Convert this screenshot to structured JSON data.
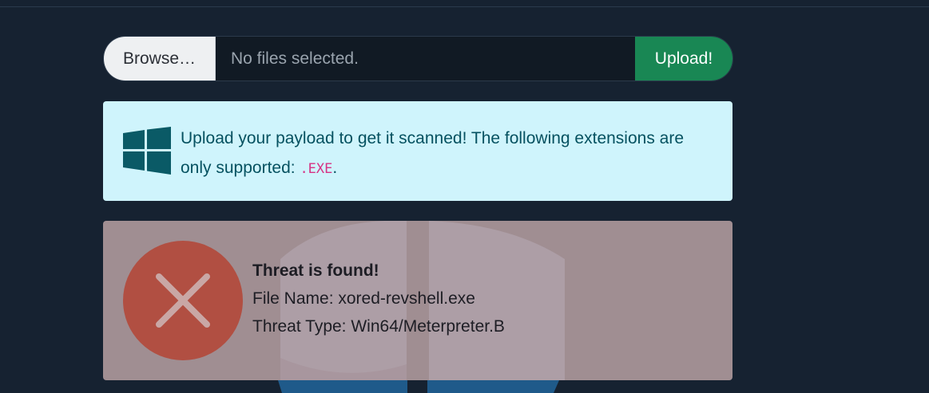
{
  "upload": {
    "browse_label": "Browse…",
    "file_status": "No files selected.",
    "upload_label": "Upload!"
  },
  "info_alert": {
    "icon": "windows-logo-icon",
    "text_before": "Upload your payload to get it scanned! The following extensions are only supported: ",
    "extension": ".EXE",
    "text_after": ".",
    "colors": {
      "background": "#cff4fc",
      "text": "#055160",
      "code": "#d63384"
    }
  },
  "threat_alert": {
    "icon": "error-x-circle-icon",
    "title": "Threat is found!",
    "file_name_line": "File Name: xored-revshell.exe",
    "threat_type_line": "Threat Type: Win64/Meterpreter.B",
    "colors": {
      "background": "#a08e92",
      "icon_circle": "#b14f42"
    }
  },
  "accent_colors": {
    "upload_button": "#198754",
    "page_background": "#162231"
  }
}
